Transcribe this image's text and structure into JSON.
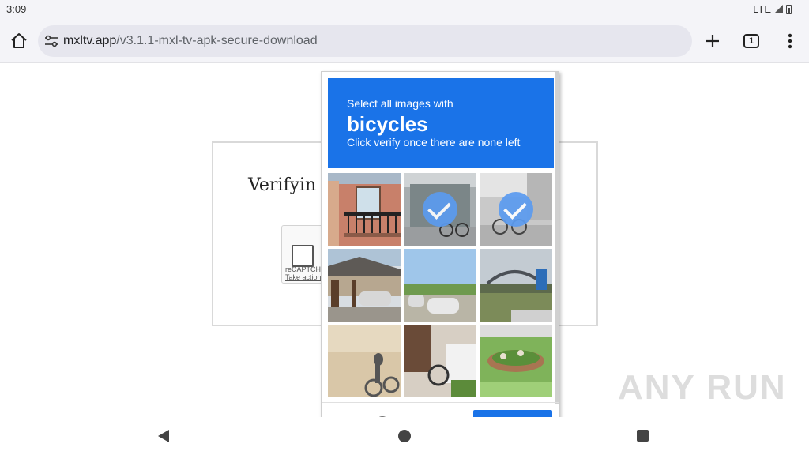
{
  "status_bar": {
    "time": "3:09",
    "network": "LTE"
  },
  "browser": {
    "url_domain": "mxltv.app",
    "url_path": "/v3.1.1-mxl-tv-apk-secure-download",
    "tab_count": "1"
  },
  "page": {
    "verifying_text": "Verifyin",
    "trailing_dot": ".",
    "recaptcha_brand": "reCAPTCHA",
    "recaptcha_action": "Take action"
  },
  "challenge": {
    "instruction": "Select all images with",
    "target": "bicycles",
    "hint": "Click verify once there are none left",
    "header_color": "#1a73e8",
    "tiles": [
      {
        "name": "building-balcony",
        "selected": false
      },
      {
        "name": "street-cyclist",
        "selected": true
      },
      {
        "name": "sidewalk-cyclist",
        "selected": true
      },
      {
        "name": "carport-house",
        "selected": false
      },
      {
        "name": "field-cars",
        "selected": false
      },
      {
        "name": "bridge-road",
        "selected": false
      },
      {
        "name": "shadow-cyclist",
        "selected": false
      },
      {
        "name": "bicycle-doorway",
        "selected": false
      },
      {
        "name": "garden-flowerbed",
        "selected": false
      }
    ]
  },
  "watermark": "ANY RUN"
}
